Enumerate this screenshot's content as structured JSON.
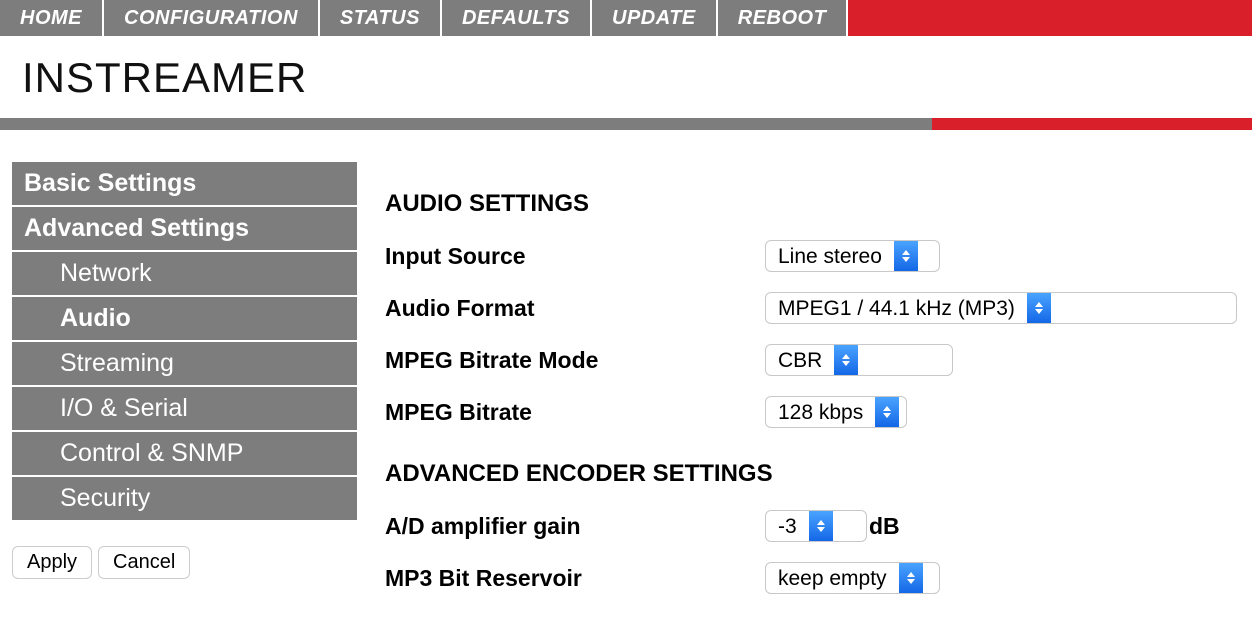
{
  "colors": {
    "accent": "#d91f2a",
    "gray": "#7d7d7d"
  },
  "topnav": {
    "items": [
      {
        "label": "HOME"
      },
      {
        "label": "CONFIGURATION"
      },
      {
        "label": "STATUS"
      },
      {
        "label": "DEFAULTS"
      },
      {
        "label": "UPDATE"
      },
      {
        "label": "REBOOT"
      }
    ]
  },
  "page": {
    "title": "INSTREAMER"
  },
  "sidebar": {
    "items": [
      {
        "label": "Basic Settings",
        "heading": true,
        "sub": false,
        "active": false
      },
      {
        "label": "Advanced Settings",
        "heading": true,
        "sub": false,
        "active": false
      },
      {
        "label": "Network",
        "heading": false,
        "sub": true,
        "active": false
      },
      {
        "label": "Audio",
        "heading": false,
        "sub": true,
        "active": true
      },
      {
        "label": "Streaming",
        "heading": false,
        "sub": true,
        "active": false
      },
      {
        "label": "I/O & Serial",
        "heading": false,
        "sub": true,
        "active": false
      },
      {
        "label": "Control & SNMP",
        "heading": false,
        "sub": true,
        "active": false
      },
      {
        "label": "Security",
        "heading": false,
        "sub": true,
        "active": false
      }
    ],
    "apply_label": "Apply",
    "cancel_label": "Cancel"
  },
  "main": {
    "section_audio": "AUDIO SETTINGS",
    "section_encoder": "ADVANCED ENCODER SETTINGS",
    "fields": {
      "input_source": {
        "label": "Input Source",
        "value": "Line stereo"
      },
      "audio_format": {
        "label": "Audio Format",
        "value": "MPEG1 / 44.1 kHz (MP3)"
      },
      "mpeg_bitrate_mode": {
        "label": "MPEG Bitrate Mode",
        "value": "CBR"
      },
      "mpeg_bitrate": {
        "label": "MPEG Bitrate",
        "value": "128 kbps"
      },
      "ad_gain": {
        "label": "A/D amplifier gain",
        "value": "-3",
        "unit": "dB"
      },
      "mp3_reservoir": {
        "label": "MP3 Bit Reservoir",
        "value": "keep empty"
      }
    }
  }
}
